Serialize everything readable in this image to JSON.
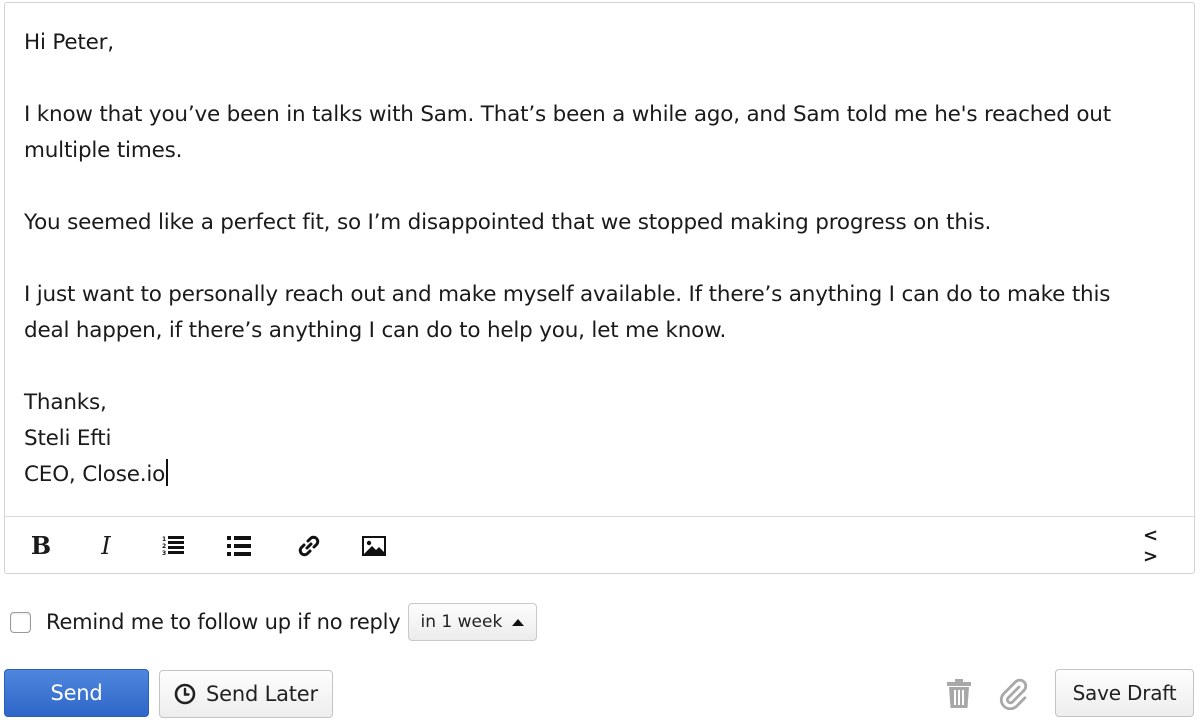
{
  "email": {
    "greeting": "Hi Peter,",
    "paragraph1_line1": "I know that you’ve been in talks with Sam. That’s been a while ago, and Sam told me he's reached out",
    "paragraph1_line2": "multiple times.",
    "paragraph2": "You seemed like a perfect fit, so I’m disappointed that we stopped making progress on this.",
    "paragraph3_line1": "I just want to personally reach out and make myself available. If there’s anything I can do to make this",
    "paragraph3_line2": "deal happen, if there’s anything I can do to help you, let me know.",
    "signoff": "Thanks,",
    "signature_name": "Steli Efti",
    "signature_title": "CEO, Close.io"
  },
  "toolbar": {
    "bold_label": "B",
    "italic_label": "I",
    "code_label": "< >",
    "icons": [
      "bold-icon",
      "italic-icon",
      "ordered-list-icon",
      "unordered-list-icon",
      "link-icon",
      "image-icon",
      "code-view-icon"
    ]
  },
  "reminder": {
    "label": "Remind me to follow up if no reply",
    "checked": false,
    "selected_interval": "in 1 week"
  },
  "actions": {
    "send_label": "Send",
    "send_later_label": "Send Later",
    "save_draft_label": "Save Draft",
    "icons": [
      "trash-icon",
      "paperclip-icon",
      "clock-icon"
    ]
  },
  "colors": {
    "send_button": "#3a72d4",
    "text": "#1a1a1a",
    "border": "#d4d4d4",
    "muted_icon": "#a8a8a8"
  }
}
